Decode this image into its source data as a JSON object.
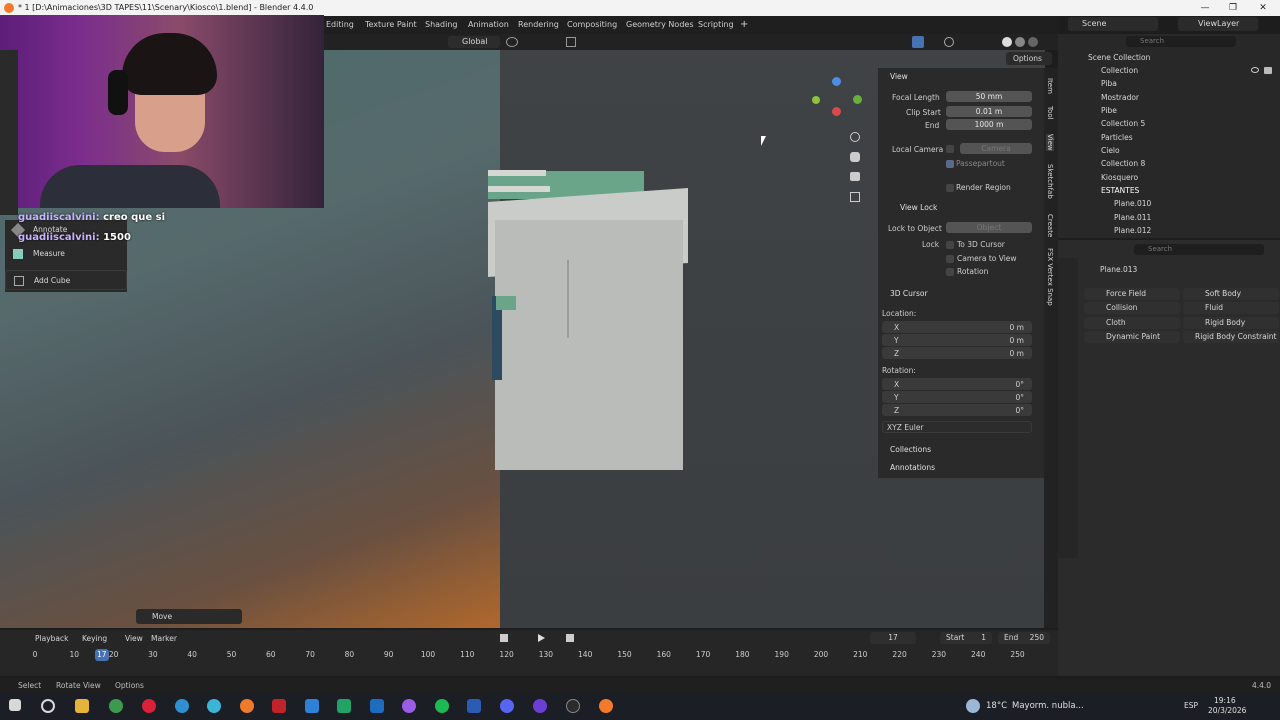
{
  "window": {
    "title": "* 1 [D:\\Animaciones\\3D TAPES\\11\\Scenary\\Kiosco\\1.blend] - Blender 4.4.0",
    "minimize": "—",
    "maximize": "❐",
    "close": "✕"
  },
  "workspaces": [
    "Editing",
    "Texture Paint",
    "Shading",
    "Animation",
    "Rendering",
    "Compositing",
    "Geometry Nodes",
    "Scripting"
  ],
  "workspace_add": "+",
  "header": {
    "scene": "Scene",
    "view_layer": "ViewLayer",
    "transform_orientation": "Global",
    "options": "Options"
  },
  "view_panel": {
    "title": "View",
    "focal_length_label": "Focal Length",
    "focal_length": "50 mm",
    "clip_start_label": "Clip Start",
    "clip_start": "0.01 m",
    "end_label": "End",
    "end": "1000 m",
    "local_camera_label": "Local Camera",
    "camera_placeholder": "Camera",
    "passepartout": "Passepartout",
    "render_region": "Render Region",
    "view_lock": "View Lock",
    "lock_to_object_label": "Lock to Object",
    "object_placeholder": "Object",
    "lock_label": "Lock",
    "to_3d_cursor": "To 3D Cursor",
    "camera_to_view": "Camera to View",
    "rotation_lock": "Rotation",
    "cursor_title": "3D Cursor",
    "location_label": "Location:",
    "loc_x_label": "X",
    "loc_x": "0 m",
    "loc_y_label": "Y",
    "loc_y": "0 m",
    "loc_z_label": "Z",
    "loc_z": "0 m",
    "rotation_label": "Rotation:",
    "rot_x_label": "X",
    "rot_x": "0°",
    "rot_y_label": "Y",
    "rot_y": "0°",
    "rot_z_label": "Z",
    "rot_z": "0°",
    "euler": "XYZ Euler",
    "collections": "Collections",
    "annotations": "Annotations"
  },
  "side_tabs": [
    "Item",
    "Tool",
    "View",
    "Sketchfab",
    "Create",
    "FSX Vertex Snap"
  ],
  "outliner": {
    "search_placeholder": "Search",
    "items": [
      {
        "label": "Scene Collection"
      },
      {
        "label": "Collection"
      },
      {
        "label": "Piba"
      },
      {
        "label": "Mostrador"
      },
      {
        "label": "Pibe"
      },
      {
        "label": "Collection 5"
      },
      {
        "label": "Particles"
      },
      {
        "label": "Cielo"
      },
      {
        "label": "Collection 8"
      },
      {
        "label": "Kiosquero"
      },
      {
        "label": "ESTANTES"
      },
      {
        "label": "Plane.010"
      },
      {
        "label": "Plane.011"
      },
      {
        "label": "Plane.012"
      }
    ]
  },
  "properties": {
    "search_placeholder": "Search",
    "object": "Plane.013",
    "buttons": [
      "Force Field",
      "Soft Body",
      "Collision",
      "Fluid",
      "Cloth",
      "Rigid Body",
      "Dynamic Paint",
      "Rigid Body Constraint"
    ]
  },
  "tools": {
    "annotate": "Annotate",
    "measure": "Measure",
    "add_cube": "Add Cube"
  },
  "chat": [
    {
      "user": "guadiiscalvini:",
      "message": "creo que si"
    },
    {
      "user": "guadiiscalvini:",
      "message": "1500"
    }
  ],
  "operator_panel": {
    "label": "Move"
  },
  "timeline": {
    "playback": "Playback",
    "keying": "Keying",
    "view": "View",
    "marker": "Marker",
    "current_frame": "17",
    "start_label": "Start",
    "start": "1",
    "end_label": "End",
    "end": "250",
    "playhead": "17",
    "ticks": [
      "0",
      "10",
      "20",
      "30",
      "40",
      "50",
      "60",
      "70",
      "80",
      "90",
      "100",
      "110",
      "120",
      "130",
      "140",
      "150",
      "160",
      "170",
      "180",
      "190",
      "200",
      "210",
      "220",
      "230",
      "240",
      "250"
    ]
  },
  "statusbar": {
    "select": "Select",
    "rotate_view": "Rotate View",
    "options": "Options",
    "version": "4.4.0"
  },
  "taskbar": {
    "weather_temp": "18°C",
    "weather_text": "Mayorm. nubla...",
    "language": "ESP",
    "time": "19:16",
    "date": "20/3/2026"
  },
  "colors": {
    "accent": "#4772b3",
    "green": "#6aa58a",
    "orange": "#f5792a"
  }
}
